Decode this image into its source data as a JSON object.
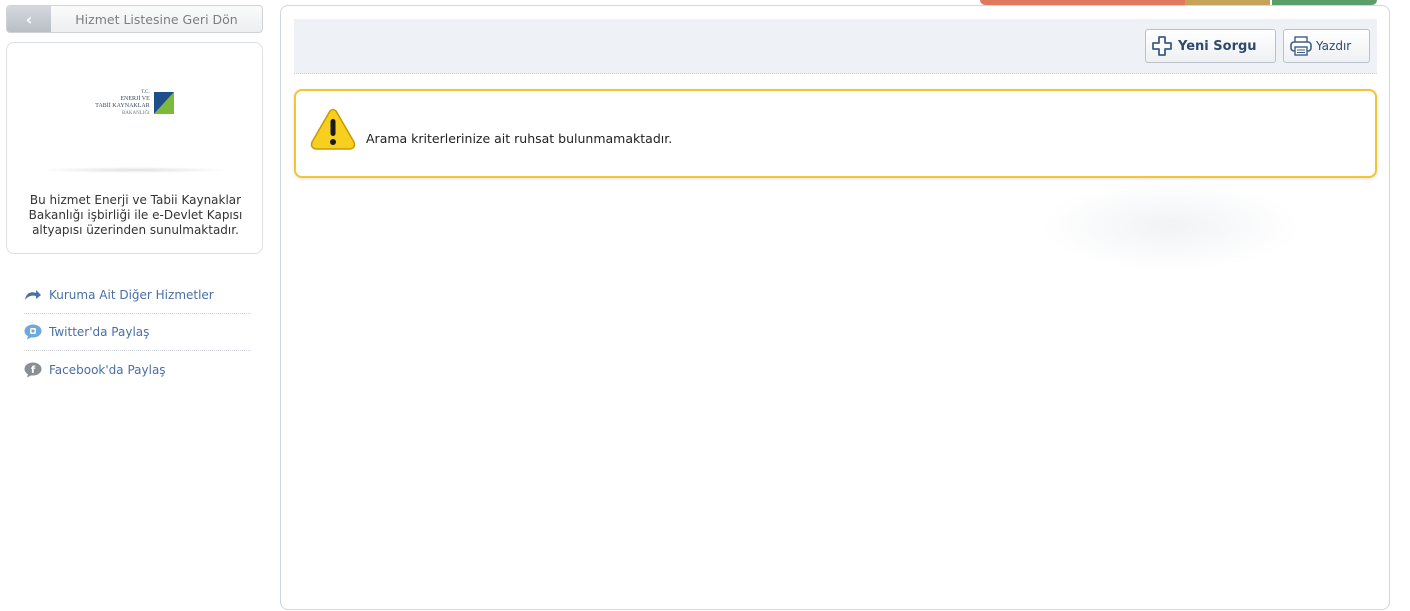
{
  "back_button": {
    "label": "Hizmet Listesine Geri Dön"
  },
  "institution": {
    "logo_lines": [
      "T.C.",
      "ENERJİ VE",
      "TABİİ KAYNAKLAR",
      "BAKANLIĞI"
    ],
    "description": "Bu hizmet Enerji ve Tabii Kaynaklar Bakanlığı işbirliği ile e-Devlet Kapısı altyapısı üzerinden sunulmaktadır."
  },
  "side_links": [
    {
      "label": "Kuruma Ait Diğer Hizmetler",
      "icon": "arrow-curve-icon"
    },
    {
      "label": "Twitter'da Paylaş",
      "icon": "twitter-bubble-icon"
    },
    {
      "label": "Facebook'da Paylaş",
      "icon": "facebook-bubble-icon"
    }
  ],
  "toolbar": {
    "new_query_label": "Yeni Sorgu",
    "print_label": "Yazdır"
  },
  "alert": {
    "message": "Arama kriterlerinize ait ruhsat bulunmamaktadır.",
    "icon": "warning-icon",
    "border_color": "#f5c431"
  },
  "colors": {
    "link": "#4a6fa5",
    "toolbar_bg": "#eef1f5",
    "logo_blue": "#1f4e8c",
    "logo_green": "#7db93b"
  }
}
